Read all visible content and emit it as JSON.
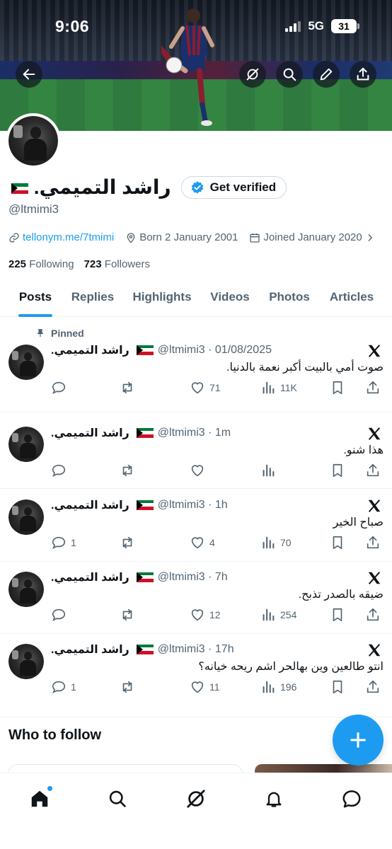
{
  "status_bar": {
    "time": "9:06",
    "network": "5G",
    "battery": "31"
  },
  "profile": {
    "display_name": "راشد التميمي.",
    "handle": "@ltmimi3",
    "verify_label": "Get verified",
    "link": "tellonym.me/7tmimi",
    "born": "Born 2 January 2001",
    "joined": "Joined January 2020",
    "following_count": "225",
    "following_label": "Following",
    "followers_count": "723",
    "followers_label": "Followers"
  },
  "tabs": [
    {
      "label": "Posts",
      "active": true
    },
    {
      "label": "Replies"
    },
    {
      "label": "Highlights"
    },
    {
      "label": "Videos"
    },
    {
      "label": "Photos"
    },
    {
      "label": "Articles"
    }
  ],
  "posts": [
    {
      "pinned_label": "Pinned",
      "name": "راشد التميمي.",
      "meta": "@ltmimi3 · 01/08/2025",
      "text": "صوت أمي بالبيت أكبر نعمة بالدنيا.",
      "replies": "",
      "reposts": "",
      "likes": "71",
      "views": "11K"
    },
    {
      "name": "راشد التميمي.",
      "meta": "@ltmimi3 · 1m",
      "text": "هذا شنو.",
      "replies": "",
      "reposts": "",
      "likes": "",
      "views": ""
    },
    {
      "name": "راشد التميمي.",
      "meta": "@ltmimi3 · 1h",
      "text": "صباح الخير",
      "replies": "1",
      "reposts": "",
      "likes": "4",
      "views": "70"
    },
    {
      "name": "راشد التميمي.",
      "meta": "@ltmimi3 · 7h",
      "text": "ضيقه بالصدر تذبح.",
      "replies": "",
      "reposts": "",
      "likes": "12",
      "views": "254"
    },
    {
      "name": "راشد التميمي.",
      "meta": "@ltmimi3 · 17h",
      "text": "انتو طالعين وين بهالحر اشم ريحه خيانه؟",
      "replies": "1",
      "reposts": "",
      "likes": "11",
      "views": "196"
    }
  ],
  "who_to_follow": {
    "title": "Who to follow"
  },
  "icons": {
    "header": [
      "back-arrow-icon",
      "grok-icon",
      "search-icon",
      "edit-icon",
      "share-icon"
    ],
    "bottom_nav": [
      "home-icon",
      "search-icon",
      "grok-icon",
      "bell-icon",
      "messages-icon"
    ]
  },
  "colors": {
    "accent": "#1d9bf0",
    "text": "#0f1419",
    "muted": "#536471"
  }
}
